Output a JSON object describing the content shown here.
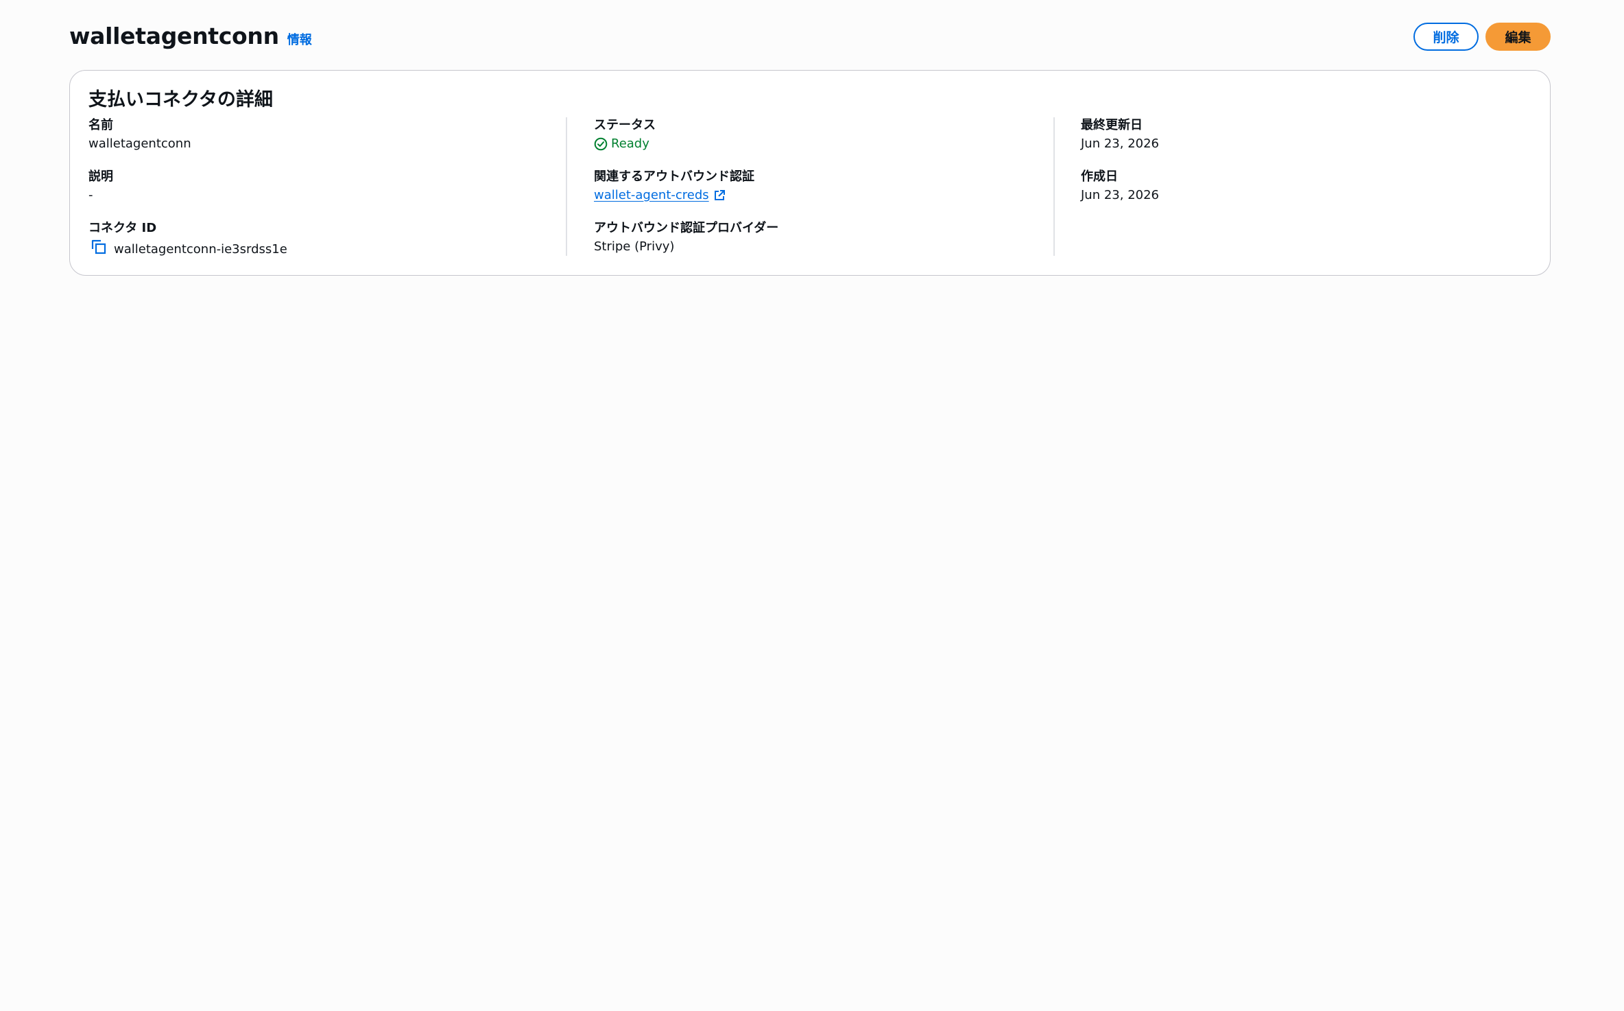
{
  "header": {
    "title": "walletagentconn",
    "info_link": "情報",
    "delete_label": "削除",
    "edit_label": "編集"
  },
  "card": {
    "title": "支払いコネクタの詳細",
    "name": {
      "label": "名前",
      "value": "walletagentconn"
    },
    "description": {
      "label": "説明",
      "value": "-"
    },
    "connector_id": {
      "label": "コネクタ ID",
      "value": "walletagentconn-ie3srdss1e",
      "icon": "copy-icon"
    },
    "status": {
      "label": "ステータス",
      "value": "Ready",
      "icon": "check-circle-icon",
      "color": "#00802f"
    },
    "outbound_auth": {
      "label": "関連するアウトバウンド認証",
      "value": "wallet-agent-creds",
      "icon": "external-link-icon"
    },
    "outbound_provider": {
      "label": "アウトバウンド認証プロバイダー",
      "value": "Stripe (Privy)"
    },
    "last_updated": {
      "label": "最終更新日",
      "value": "Jun 23, 2026"
    },
    "created": {
      "label": "作成日",
      "value": "Jun 23, 2026"
    }
  },
  "colors": {
    "link": "#006ce0",
    "primary_button": "#f59a36",
    "success": "#00802f",
    "background": "#fcfcfc"
  }
}
